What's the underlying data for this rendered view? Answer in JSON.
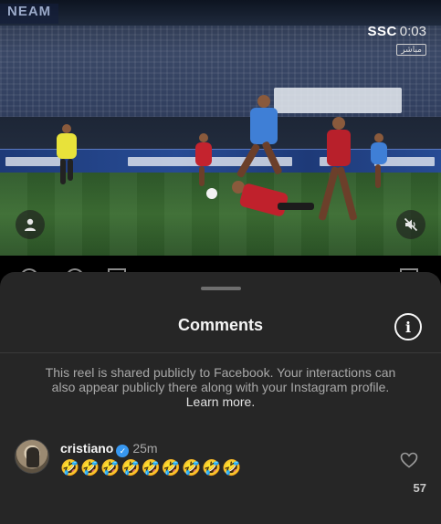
{
  "video": {
    "corner_logo": "NEAM",
    "broadcaster": "SSC",
    "timer": "0:03",
    "live_tag": "مباشر",
    "profile_icon": "person-icon",
    "mute_icon": "speaker-muted-icon"
  },
  "sheet": {
    "title": "Comments",
    "info_icon": "info-icon",
    "notice": "This reel is shared publicly to Facebook. Your interactions can also appear publicly there along with your Instagram profile.",
    "learn_more": "Learn more."
  },
  "comments": [
    {
      "username": "cristiano",
      "verified": true,
      "time": "25m",
      "text": "🤣🤣🤣🤣🤣🤣🤣🤣🤣",
      "likes": "57"
    }
  ],
  "colors": {
    "sheet_bg": "#262626",
    "verified": "#3797f0",
    "muted_text": "#a8a8a8"
  }
}
